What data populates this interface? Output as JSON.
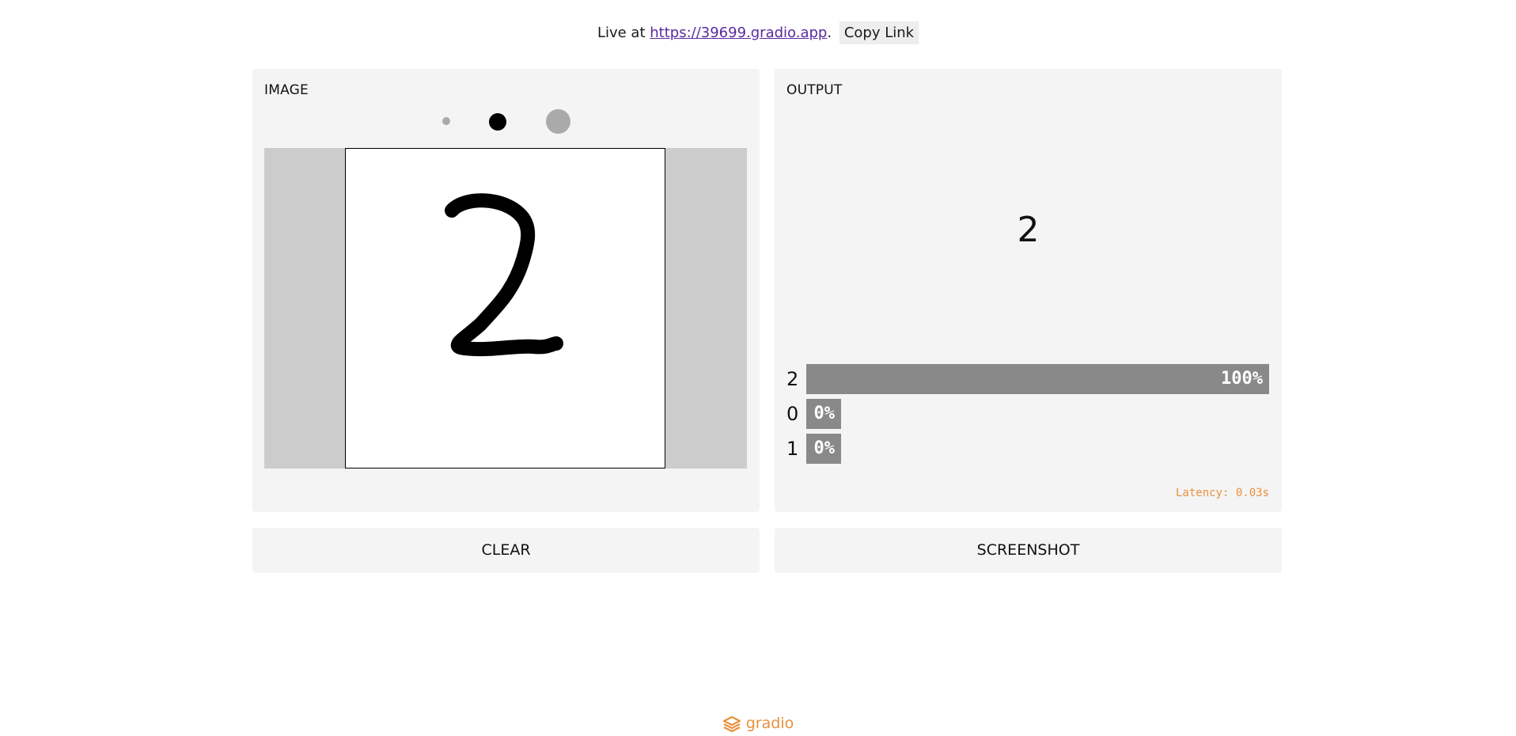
{
  "header": {
    "live_prefix": "Live at",
    "link_text": "https://39699.gradio.app",
    "link_suffix": ".",
    "copy_label": "Copy Link"
  },
  "input_panel": {
    "title": "IMAGE",
    "brush_sizes": [
      "small",
      "medium",
      "large"
    ],
    "selected_brush": "medium",
    "drawn_digit": "2"
  },
  "output_panel": {
    "title": "OUTPUT",
    "predicted_label": "2",
    "confidences": [
      {
        "label": "2",
        "value": 1.0,
        "pct": "100%"
      },
      {
        "label": "0",
        "value": 0.0,
        "pct": "0%"
      },
      {
        "label": "1",
        "value": 0.0,
        "pct": "0%"
      }
    ],
    "latency": "Latency: 0.03s"
  },
  "buttons": {
    "clear_label": "CLEAR",
    "screenshot_label": "SCREENSHOT"
  },
  "footer": {
    "brand": "gradio",
    "icon": "gradio-logo-icon"
  },
  "colors": {
    "accent": "#e8913c",
    "bar": "#898989",
    "link": "#5a2aa0"
  }
}
